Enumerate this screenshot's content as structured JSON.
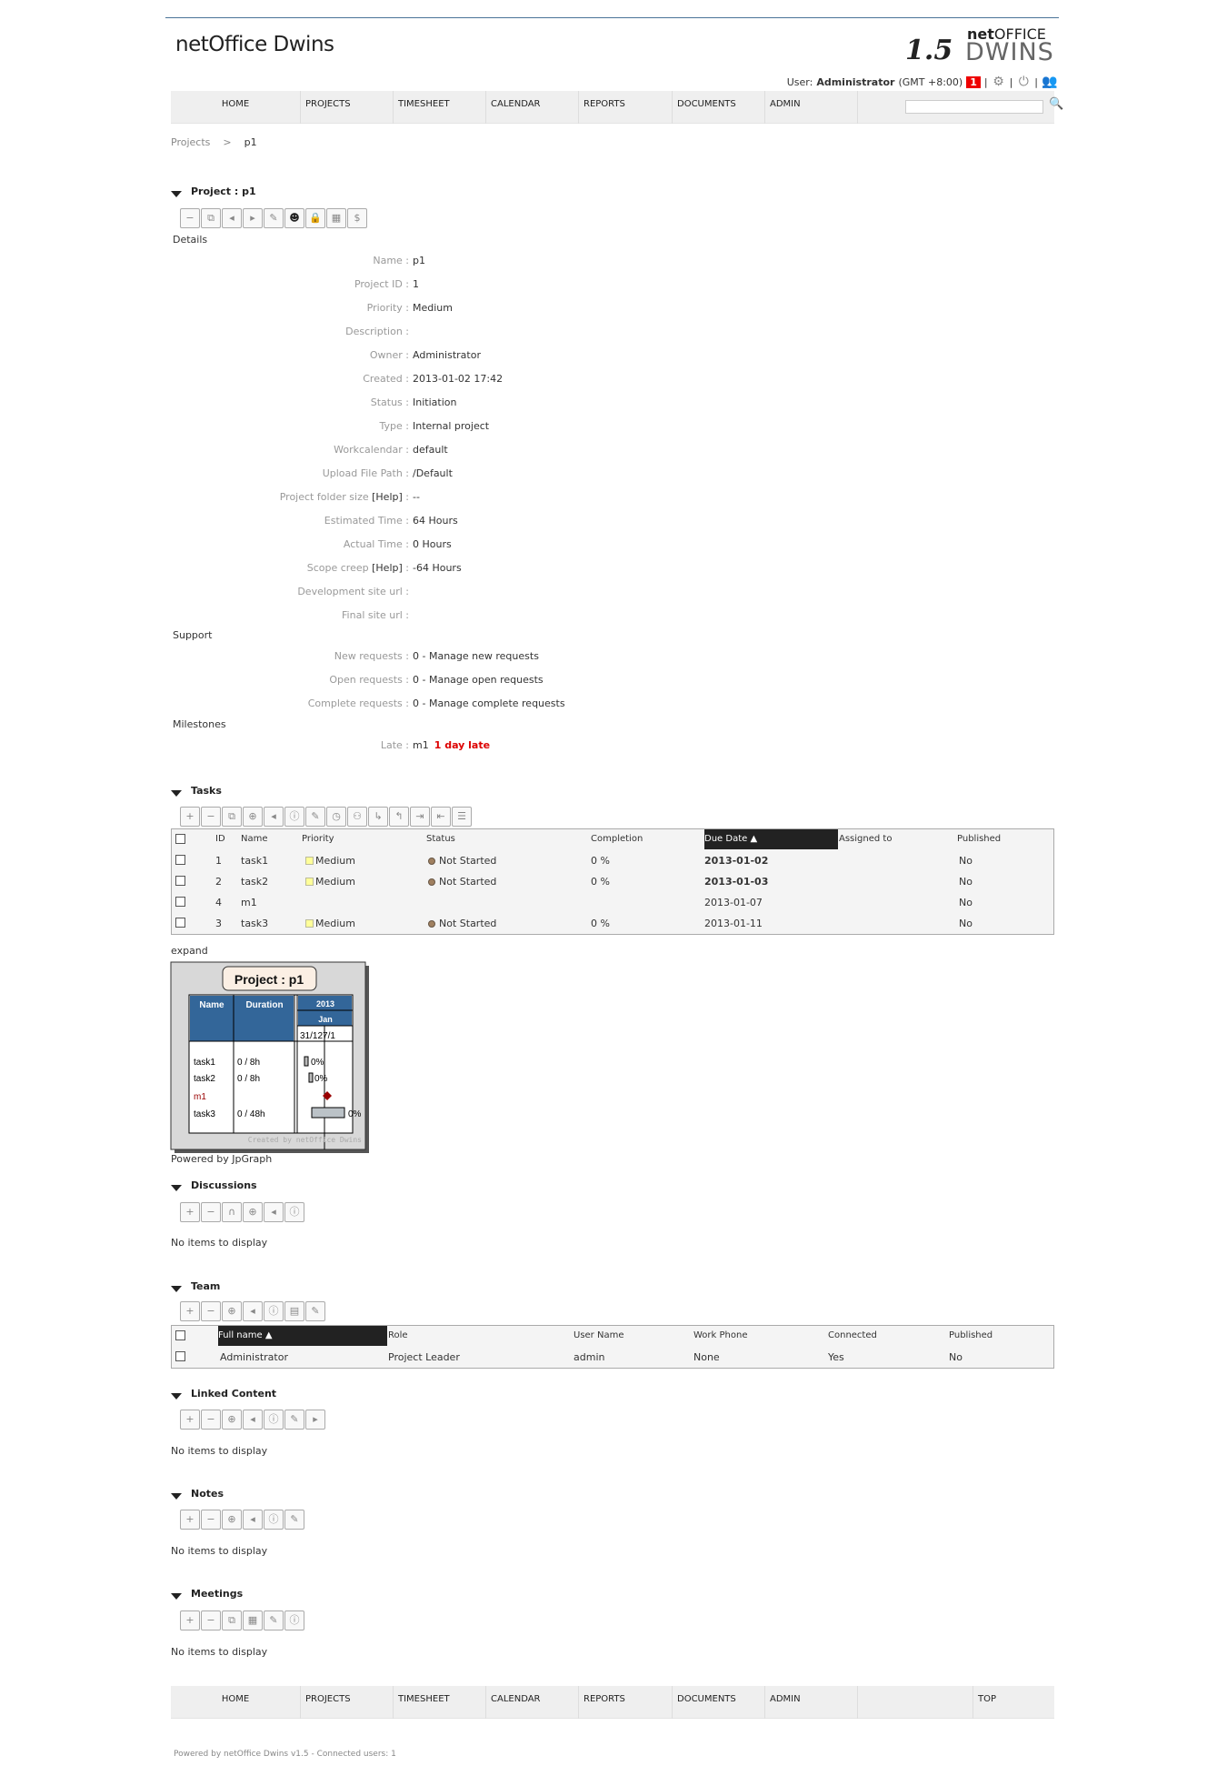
{
  "app": {
    "title": "netOffice Dwins",
    "logo_version": "1.5",
    "logo_net": "net",
    "logo_office": "OFFICE",
    "logo_dwins": "DWINS"
  },
  "user": {
    "label": "User:",
    "name": "Administrator",
    "timezone": "(GMT +8:00)",
    "notifications": "1",
    "sep": "|"
  },
  "nav": [
    "HOME",
    "PROJECTS",
    "TIMESHEET",
    "CALENDAR",
    "REPORTS",
    "DOCUMENTS",
    "ADMIN"
  ],
  "search": {
    "value": "",
    "placeholder": ""
  },
  "breadcrumb": {
    "parent": "Projects",
    "sep": ">",
    "current": "p1"
  },
  "project": {
    "heading": "Project : p1",
    "details_label": "Details",
    "fields": [
      {
        "label": "Name :",
        "value": "p1"
      },
      {
        "label": "Project ID :",
        "value": "1"
      },
      {
        "label": "Priority :",
        "value": "Medium"
      },
      {
        "label": "Description :",
        "value": ""
      },
      {
        "label": "Owner :",
        "value": "Administrator"
      },
      {
        "label": "Created :",
        "value": "2013-01-02 17:42"
      },
      {
        "label": "Status :",
        "value": "Initiation"
      },
      {
        "label": "Type :",
        "value": "Internal project"
      },
      {
        "label": "Workcalendar :",
        "value": "default"
      },
      {
        "label": "Upload File Path :",
        "value": "/Default"
      },
      {
        "label": "Project folder size",
        "help": "[Help]",
        "colon": ":",
        "value": "--"
      },
      {
        "label": "Estimated Time :",
        "value": "64 Hours"
      },
      {
        "label": "Actual Time :",
        "value": "0 Hours"
      },
      {
        "label": "Scope creep",
        "help": "[Help]",
        "colon": ":",
        "value": "-64 Hours"
      },
      {
        "label": "Development site url :",
        "value": ""
      },
      {
        "label": "Final site url :",
        "value": ""
      }
    ],
    "support_label": "Support",
    "support": [
      {
        "label": "New requests :",
        "value": "0 - Manage new requests"
      },
      {
        "label": "Open requests :",
        "value": "0 - Manage open requests"
      },
      {
        "label": "Complete requests :",
        "value": "0 - Manage complete requests"
      }
    ],
    "milestones_label": "Milestones",
    "milestone": {
      "label": "Late :",
      "name": "m1",
      "late": "1 day late"
    }
  },
  "tasks": {
    "heading": "Tasks",
    "columns": [
      "ID",
      "Name",
      "Priority",
      "Status",
      "Completion",
      "Due Date ▲",
      "Assigned to",
      "Published"
    ],
    "rows": [
      {
        "id": "1",
        "name": "task1",
        "priority": "Medium",
        "status": "Not Started",
        "completion": "0 %",
        "due": "2013-01-02",
        "due_bold": true,
        "assigned": "",
        "published": "No"
      },
      {
        "id": "2",
        "name": "task2",
        "priority": "Medium",
        "status": "Not Started",
        "completion": "0 %",
        "due": "2013-01-03",
        "due_bold": true,
        "assigned": "",
        "published": "No"
      },
      {
        "id": "4",
        "name": "m1",
        "priority": "",
        "status": "",
        "completion": "",
        "due": "2013-01-07",
        "due_bold": false,
        "assigned": "",
        "published": "No"
      },
      {
        "id": "3",
        "name": "task3",
        "priority": "Medium",
        "status": "Not Started",
        "completion": "0 %",
        "due": "2013-01-11",
        "due_bold": false,
        "assigned": "",
        "published": "No"
      }
    ],
    "expand": "expand",
    "gantt": {
      "title": "Project : p1",
      "col_name": "Name",
      "col_duration": "Duration",
      "year": "2013",
      "month": "Jan",
      "dates": "31/127/1",
      "rows": [
        {
          "name": "task1",
          "duration": "0 / 8h",
          "pct": "0%"
        },
        {
          "name": "task2",
          "duration": "0 / 8h",
          "pct": "0%"
        },
        {
          "name": "m1",
          "duration": "",
          "pct": ""
        },
        {
          "name": "task3",
          "duration": "0 / 48h",
          "pct": "0%"
        }
      ],
      "credit": "Created by netOffice Dwins"
    },
    "powered": "Powered by JpGraph"
  },
  "discussions": {
    "heading": "Discussions",
    "empty": "No items to display"
  },
  "team": {
    "heading": "Team",
    "columns": [
      "Full name ▲",
      "Role",
      "User Name",
      "Work Phone",
      "Connected",
      "Published"
    ],
    "rows": [
      {
        "name": "Administrator",
        "role": "Project Leader",
        "user": "admin",
        "phone": "None",
        "connected": "Yes",
        "published": "No"
      }
    ]
  },
  "linked": {
    "heading": "Linked Content",
    "empty": "No items to display"
  },
  "notes": {
    "heading": "Notes",
    "empty": "No items to display"
  },
  "meetings": {
    "heading": "Meetings",
    "empty": "No items to display"
  },
  "footer_nav": [
    "HOME",
    "PROJECTS",
    "TIMESHEET",
    "CALENDAR",
    "REPORTS",
    "DOCUMENTS",
    "ADMIN",
    "TOP"
  ],
  "footer": "Powered by netOffice Dwins v1.5 - Connected users: 1",
  "colors": {
    "accent_line": "#4a7497",
    "sorted_header": "#222222",
    "late": "#dd0000",
    "gantt_header": "#336699",
    "milestone": "#990000"
  }
}
